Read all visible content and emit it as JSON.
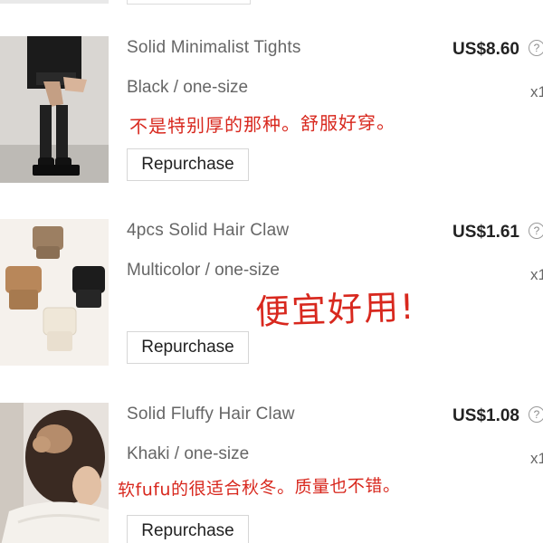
{
  "orders": [
    {
      "title": "Solid Minimalist Tights",
      "variant": "Black / one-size",
      "price": "US$8.60",
      "quantity": "x1",
      "button_label": "Repurchase",
      "handwritten_note": "不是特别厚的那种。舒服好穿。",
      "image_icon": "tights-product-photo"
    },
    {
      "title": "4pcs Solid Hair Claw",
      "variant": "Multicolor / one-size",
      "price": "US$1.61",
      "quantity": "x1",
      "button_label": "Repurchase",
      "handwritten_note": "便宜好用!",
      "image_icon": "hair-claw-set-photo"
    },
    {
      "title": "Solid Fluffy Hair Claw",
      "variant": "Khaki / one-size",
      "price": "US$1.08",
      "quantity": "x1",
      "button_label": "Repurchase",
      "handwritten_note": "软fufu的很适合秋冬。质量也不错。",
      "image_icon": "fluffy-hair-claw-photo"
    }
  ],
  "price_help_icon": "?",
  "colors": {
    "note_red": "#d8281e",
    "text_gray": "#666666",
    "price_dark": "#222222",
    "border": "#d6d6d6"
  }
}
